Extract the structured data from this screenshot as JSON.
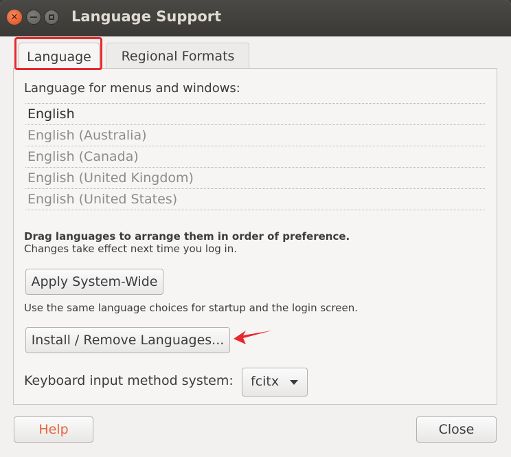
{
  "window": {
    "title": "Language Support"
  },
  "tabs": [
    {
      "label": "Language",
      "active": true
    },
    {
      "label": "Regional Formats",
      "active": false
    }
  ],
  "language": {
    "list_label": "Language for menus and windows:",
    "items": [
      "English",
      "English (Australia)",
      "English (Canada)",
      "English (United Kingdom)",
      "English (United States)"
    ],
    "drag_hint_bold": "Drag languages to arrange them in order of preference.",
    "drag_hint": "Changes take effect next time you log in.",
    "apply_button": "Apply System-Wide",
    "apply_hint": "Use the same language choices for startup and the login screen.",
    "install_button": "Install / Remove Languages...",
    "keyboard_label": "Keyboard input method system:",
    "keyboard_value": "fcitx"
  },
  "footer": {
    "help_label": "Help",
    "close_label": "Close"
  },
  "colors": {
    "help_text": "#e8643a",
    "annotation_red": "#e8272c",
    "titlebar": "#3c3b37",
    "close_button": "#df4b16"
  }
}
